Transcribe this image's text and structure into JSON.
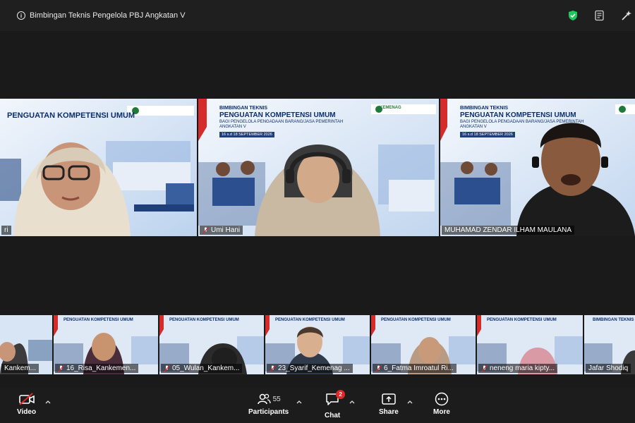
{
  "window": {
    "title": "Bimbingan Teknis Pengelola PBJ Angkatan V"
  },
  "slide": {
    "heading_small": "BIMBINGAN TEKNIS",
    "heading_big": "PENGUATAN KOMPETENSI UMUM",
    "subheading": "BAGI PENGELOLA PENGADAAN BARANG/JASA PEMERINTAH",
    "batch": "ANGKATAN V",
    "date": "16 s.d 18 SEPTEMBER 2026",
    "org": "KEMENAG"
  },
  "speakers": [
    {
      "name": "ri"
    },
    {
      "name": "Umi Hani"
    },
    {
      "name": "MUHAMAD ZENDAR ILHAM MAULANA"
    }
  ],
  "gallery": [
    {
      "name": "Kankem..."
    },
    {
      "name": "16_Risa_Kankemen..."
    },
    {
      "name": "05_Wulan_Kankem..."
    },
    {
      "name": "23_Syarif_Kemenag ..."
    },
    {
      "name": "6_Fatma Imroatul Ri..."
    },
    {
      "name": "neneng maria kipty..."
    },
    {
      "name": "Jafar Shodiq"
    }
  ],
  "toolbar": {
    "video_label": "Video",
    "participants_label": "Participants",
    "participants_count": "55",
    "chat_label": "Chat",
    "chat_badge": "2",
    "share_label": "Share",
    "more_label": "More"
  }
}
